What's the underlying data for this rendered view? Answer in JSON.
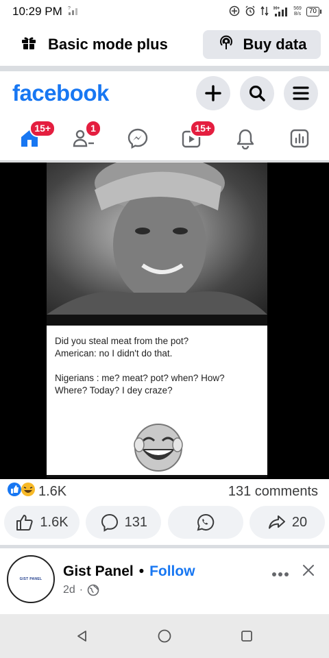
{
  "status_bar": {
    "time": "10:29 PM",
    "speed_value": "569",
    "speed_unit": "B/s",
    "battery": "70"
  },
  "mode_bar": {
    "title": "Basic mode plus",
    "buy_data_label": "Buy data"
  },
  "header": {
    "logo": "facebook"
  },
  "nav": {
    "home_badge": "15+",
    "friends_badge": "1",
    "video_badge": "15+"
  },
  "post": {
    "caption_line1": "Did you steal meat from the pot?",
    "caption_line2": "American: no I didn't do that.",
    "caption_line3": "Nigerians : me? meat? pot? when? How?",
    "caption_line4": "Where? Today? I dey craze?",
    "reaction_count": "1.6K",
    "comments_count": "131 comments",
    "like_count": "1.6K",
    "comment_btn_count": "131",
    "share_count": "20"
  },
  "next_post": {
    "page_name": "Gist Panel",
    "follow_label": "Follow",
    "time_ago": "2d",
    "avatar_text": "GIST PANEL"
  },
  "colors": {
    "brand": "#1877f2",
    "badge": "#e41e3f"
  }
}
